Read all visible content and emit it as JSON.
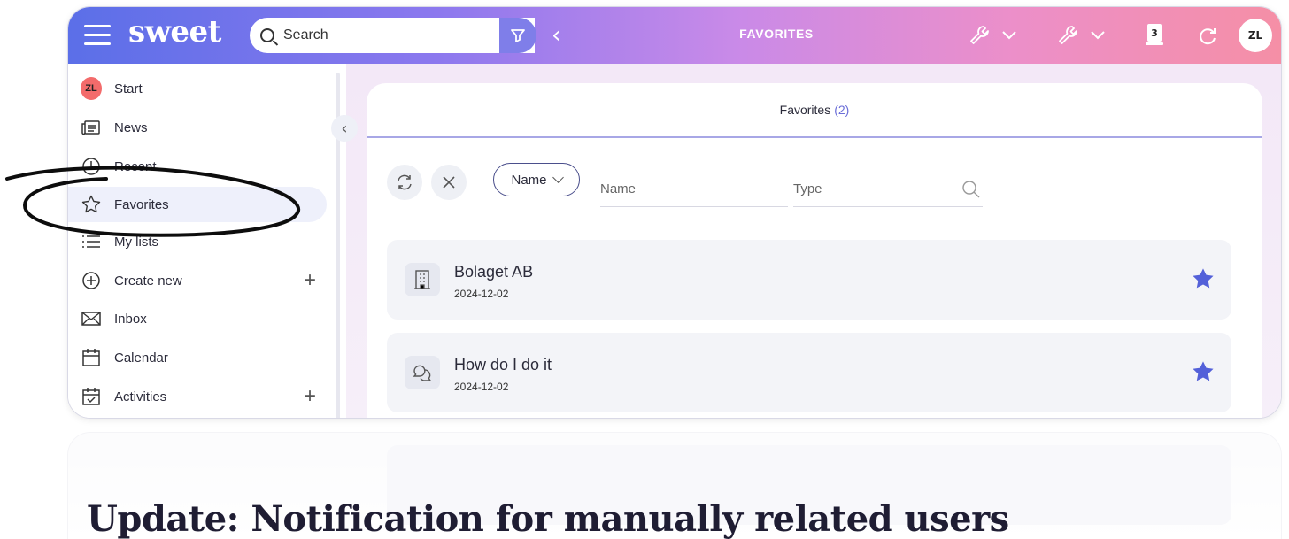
{
  "app": {
    "logo": "sweet",
    "search_placeholder": "Search",
    "page_title": "FAVORITES",
    "user_initials": "ZL",
    "notification_count": "3"
  },
  "sidebar": {
    "items": [
      {
        "label": "Start",
        "icon": "avatar-icon"
      },
      {
        "label": "News",
        "icon": "news-icon"
      },
      {
        "label": "Recent",
        "icon": "clock-icon"
      },
      {
        "label": "Favorites",
        "icon": "star-icon",
        "active": true
      },
      {
        "label": "My lists",
        "icon": "list-icon"
      },
      {
        "label": "Create new",
        "icon": "plus-circle-icon"
      },
      {
        "label": "Inbox",
        "icon": "mail-icon"
      },
      {
        "label": "Calendar",
        "icon": "calendar-icon"
      },
      {
        "label": "Activities",
        "icon": "activities-icon"
      }
    ]
  },
  "panel": {
    "title": "Favorites",
    "count": "(2)",
    "sort_chip": "Name",
    "name_placeholder": "Name",
    "type_placeholder": "Type"
  },
  "favorites": [
    {
      "title": "Bolaget AB",
      "date": "2024-12-02",
      "icon": "building-icon"
    },
    {
      "title": "How do I do it",
      "date": "2024-12-02",
      "icon": "chat-icon"
    }
  ],
  "headline": "Update: Notification for manually related users",
  "colors": {
    "accent": "#5b6fe8",
    "star": "#5360d9",
    "avatar": "#f36b6b"
  }
}
